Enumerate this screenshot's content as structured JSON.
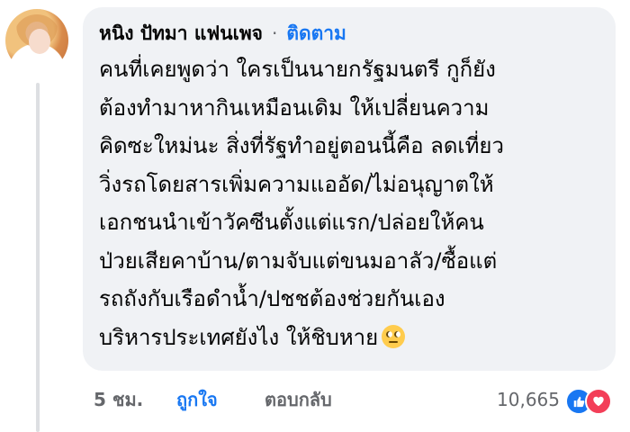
{
  "comment": {
    "author": "หนิง ปัทมา แฟนเพจ",
    "separator": "·",
    "follow_label": "ติดตาม",
    "lines": [
      "คนที่เคยพูดว่า ใครเป็นนายกรัฐมนตรี กูก็ยัง",
      "ต้องทำมาหากินเหมือนเดิม ให้เปลี่ยนความ",
      "คิดซะใหม่นะ สิ่งที่รัฐทำอยู่ตอนนี้คือ ลดเที่ยว",
      "วิ่งรถโดยสารเพิ่มความแออัด/ไม่อนุญาตให้",
      "เอกชนนำเข้าวัคซีนตั้งแต่แรก/ปล่อยให้คน",
      "ป่วยเสียคาบ้าน/ตามจับแต่ขนมอาลัว/ซื้อแต่",
      "รถถังกับเรือดำน้ำ/ปชชต้องช่วยกันเอง",
      "บริหารประเทศยังไง ให้ชิบหาย"
    ],
    "emoji_icon": "face-with-rolling-eyes-icon"
  },
  "footer": {
    "time": "5 ชม.",
    "like_label": "ถูกใจ",
    "reply_label": "ตอบกลับ",
    "reaction_count": "10,665",
    "reaction_icons": [
      "like-reaction-icon",
      "love-reaction-icon"
    ]
  },
  "colors": {
    "link_blue": "#1877f2",
    "bubble_bg": "#f0f2f5",
    "meta_gray": "#65676b",
    "love_red": "#f33e58"
  }
}
